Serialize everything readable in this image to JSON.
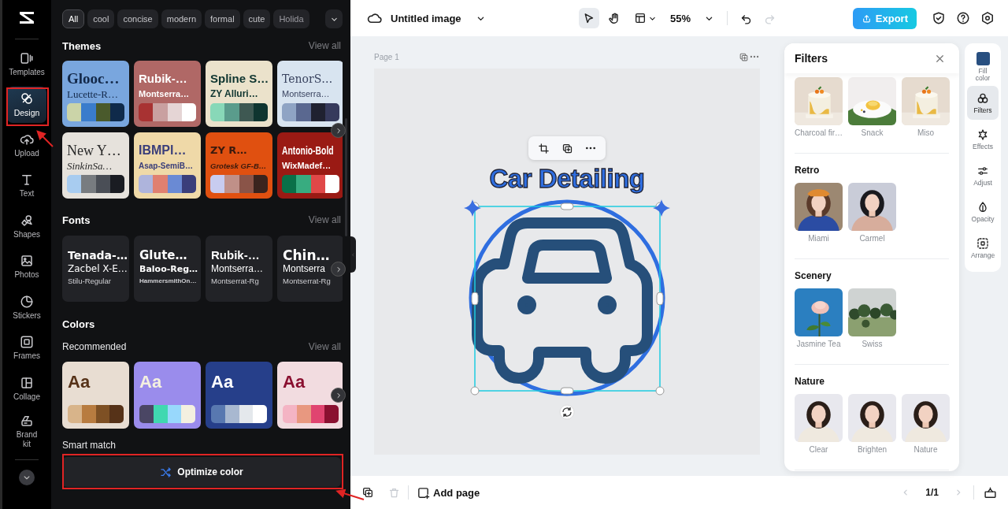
{
  "rail": {
    "items": [
      {
        "label": "Templates",
        "selected": false
      },
      {
        "label": "Design",
        "selected": true
      },
      {
        "label": "Upload",
        "selected": false
      },
      {
        "label": "Text",
        "selected": false
      },
      {
        "label": "Shapes",
        "selected": false
      },
      {
        "label": "Photos",
        "selected": false
      },
      {
        "label": "Stickers",
        "selected": false
      },
      {
        "label": "Frames",
        "selected": false
      },
      {
        "label": "Collage",
        "selected": false
      },
      {
        "label": "Brand kit",
        "selected": false
      }
    ]
  },
  "style_chips": [
    {
      "label": "All",
      "selected": true
    },
    {
      "label": "cool",
      "selected": false
    },
    {
      "label": "concise",
      "selected": false
    },
    {
      "label": "modern",
      "selected": false
    },
    {
      "label": "formal",
      "selected": false
    },
    {
      "label": "cute",
      "selected": false
    },
    {
      "label": "Holida",
      "selected": false
    }
  ],
  "themes": {
    "title": "Themes",
    "view_all": "View all",
    "cards": [
      {
        "lines": [
          "Glooc…",
          "Lucette-R…"
        ],
        "color": "#79a6de",
        "palette": [
          {
            "color": "#cbd4a8"
          },
          {
            "color": "#3a7ccc"
          },
          {
            "color": "#4a5a2c"
          },
          {
            "color": "#0f2a4a"
          }
        ]
      },
      {
        "lines": [
          "Rubik-…",
          "Montserra…"
        ],
        "color": "#b06866",
        "palette": [
          {
            "color": "#a83232"
          },
          {
            "color": "#c9a0a0"
          },
          {
            "color": "#e5d5d5"
          },
          {
            "color": "#ffffff"
          }
        ]
      },
      {
        "lines": [
          "Spline S…",
          "ZY Alluri…"
        ],
        "color": "#ebe2cb",
        "palette": [
          {
            "color": "#88d8b8"
          },
          {
            "color": "#5a9c8c"
          },
          {
            "color": "#3e5852"
          },
          {
            "color": "#0f3530"
          }
        ]
      },
      {
        "lines": [
          "TenorS…",
          "Montserra…"
        ],
        "color": "#d8e4f0",
        "palette": [
          {
            "color": "#8fa4c4"
          },
          {
            "color": "#5a6890"
          },
          {
            "color": "#1f2130"
          },
          {
            "color": "#363a5c"
          }
        ]
      },
      {
        "lines": [
          "New Y…",
          "SinkinSa…"
        ],
        "color": "#e6e2dc",
        "palette": [
          {
            "color": "#a8ccf0"
          },
          {
            "color": "#787c80"
          },
          {
            "color": "#4a4e56"
          },
          {
            "color": "#1a1c22"
          }
        ]
      },
      {
        "lines": [
          "IBMPl…",
          "Asap-SemiB…"
        ],
        "color": "#efd9a8",
        "palette": [
          {
            "color": "#aeb4dc"
          },
          {
            "color": "#e08070"
          },
          {
            "color": "#6a8ad4"
          },
          {
            "color": "#3a3e7a"
          }
        ]
      },
      {
        "lines": [
          "ZY R…",
          "Grotesk GF-B…"
        ],
        "color": "#e05010",
        "palette": [
          {
            "color": "#c8ccf0"
          },
          {
            "color": "#c09088"
          },
          {
            "color": "#8a5448"
          },
          {
            "color": "#3a241e"
          }
        ]
      },
      {
        "lines": [
          "Antonio-Bold",
          "WixMadef…"
        ],
        "color": "#9a1a14",
        "palette": [
          {
            "color": "#0a7048"
          },
          {
            "color": "#38ac80"
          },
          {
            "color": "#e04848"
          },
          {
            "color": "#ffffff"
          }
        ]
      }
    ]
  },
  "fonts": {
    "title": "Fonts",
    "view_all": "View all",
    "cards": [
      {
        "lines": [
          "Tenada-…",
          "Zacbel X-E…",
          "Stilu-Regular"
        ]
      },
      {
        "lines": [
          "Glute…",
          "Baloo-Reg…",
          "HammersmithOn…"
        ]
      },
      {
        "lines": [
          "Rubik-…",
          "Montserra…",
          "Montserrat-Rg"
        ]
      },
      {
        "lines": [
          "Chin…",
          "Montserra",
          "Montserrat-Rg"
        ]
      }
    ]
  },
  "colors": {
    "title": "Colors",
    "subtitle": "Recommended",
    "view_all": "View all",
    "cards": [
      {
        "sample": "Aa",
        "color": "#e8ddd2",
        "palette": [
          {
            "color": "#d8b48a"
          },
          {
            "color": "#b87c40"
          },
          {
            "color": "#7e5024"
          },
          {
            "color": "#563218"
          }
        ]
      },
      {
        "sample": "Aa",
        "color": "#9a8cec",
        "palette": [
          {
            "color": "#4a4664"
          },
          {
            "color": "#40d8b0"
          },
          {
            "color": "#98d8fc"
          },
          {
            "color": "#f4f0e0"
          }
        ]
      },
      {
        "sample": "Aa",
        "color": "#263f8a",
        "palette": [
          {
            "color": "#5878b0"
          },
          {
            "color": "#a8b8d0"
          },
          {
            "color": "#e4e8ec"
          },
          {
            "color": "#ffffff"
          }
        ]
      },
      {
        "sample": "Aa",
        "color": "#f2dce0",
        "palette": [
          {
            "color": "#f4b4c4"
          },
          {
            "color": "#e89880"
          },
          {
            "color": "#e04470"
          },
          {
            "color": "#8a1030"
          }
        ]
      }
    ]
  },
  "smart_match": {
    "label": "Smart match",
    "button": "Optimize color"
  },
  "top_bar": {
    "title": "Untitled image",
    "zoom": "55%",
    "export": "Export",
    "redo_disabled": true,
    "tools": [
      {
        "kind": "pointer",
        "selected": true
      },
      {
        "kind": "hand",
        "selected": false
      }
    ]
  },
  "canvas": {
    "page_label": "Page 1",
    "heading": "Car Detailing"
  },
  "filters": {
    "title": "Filters",
    "sections": [
      {
        "items": [
          {
            "label": "Charcoal fir…"
          },
          {
            "label": "Snack"
          },
          {
            "label": "Miso"
          }
        ]
      },
      {
        "title": "Retro",
        "items": [
          {
            "label": "Miami"
          },
          {
            "label": "Carmel"
          }
        ]
      },
      {
        "title": "Scenery",
        "items": [
          {
            "label": "Jasmine Tea"
          },
          {
            "label": "Swiss"
          }
        ]
      },
      {
        "title": "Nature",
        "items": [
          {
            "label": "Clear"
          },
          {
            "label": "Brighten"
          },
          {
            "label": "Nature"
          }
        ]
      }
    ]
  },
  "tools": [
    {
      "label": "Fill color",
      "kind": "swatch",
      "color": "#284f80",
      "selected": false
    },
    {
      "label": "Filters",
      "kind": "filters",
      "selected": true
    },
    {
      "label": "Effects",
      "kind": "effects",
      "selected": false
    },
    {
      "label": "Adjust",
      "kind": "adjust",
      "selected": false
    },
    {
      "label": "Opacity",
      "kind": "opacity",
      "selected": false
    },
    {
      "label": "Arrange",
      "kind": "arrange",
      "selected": false
    }
  ],
  "bottom_bar": {
    "add_page": "Add page",
    "pager": "1/1",
    "delete_disabled": true,
    "prev_disabled": true,
    "next_disabled": true
  }
}
